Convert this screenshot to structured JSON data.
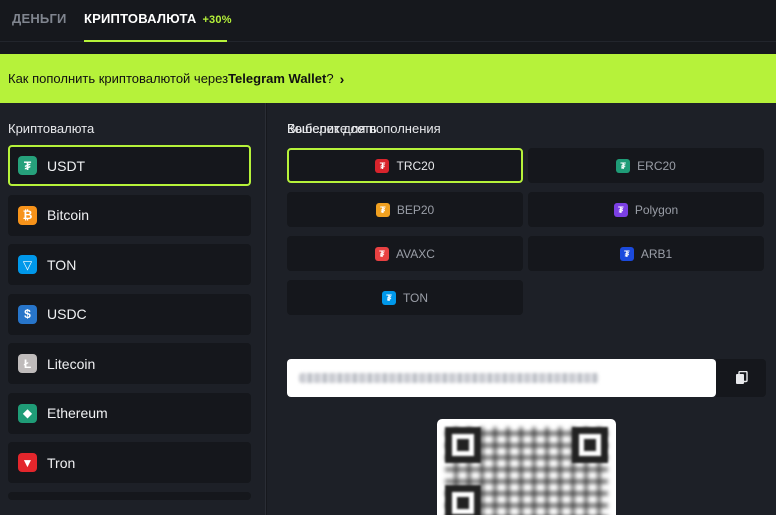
{
  "tabs": {
    "money": "Деньги",
    "crypto": "Криптовалюта",
    "crypto_badge": "+30%"
  },
  "banner": {
    "text_before": "Как пополнить криптовалютой через ",
    "text_bold": "Telegram Wallet",
    "text_after": "?",
    "chevron": "›"
  },
  "crypto_panel": {
    "title": "Криптовалюта",
    "items": [
      {
        "label": "USDT",
        "icon": "tether-icon",
        "color": "#26a17b",
        "selected": true
      },
      {
        "label": "Bitcoin",
        "icon": "bitcoin-icon",
        "color": "#f7931a",
        "selected": false
      },
      {
        "label": "TON",
        "icon": "ton-icon",
        "color": "#0098ea",
        "selected": false
      },
      {
        "label": "USDC",
        "icon": "usdc-icon",
        "color": "#2775ca",
        "selected": false
      },
      {
        "label": "Litecoin",
        "icon": "litecoin-icon",
        "color": "#bfbbbb",
        "selected": false
      },
      {
        "label": "Ethereum",
        "icon": "ethereum-icon",
        "color": "#1f9c77",
        "selected": false
      },
      {
        "label": "Tron",
        "icon": "tron-icon",
        "color": "#e3262c",
        "selected": false
      }
    ]
  },
  "network_panel": {
    "title": "Выберите сеть",
    "networks": [
      {
        "label": "TRC20",
        "color": "#d8242c",
        "selected": true
      },
      {
        "label": "ERC20",
        "color": "#1f9c77",
        "selected": false
      },
      {
        "label": "BEP20",
        "color": "#f0a020",
        "selected": false
      },
      {
        "label": "Polygon",
        "color": "#7b3fe4",
        "selected": false
      },
      {
        "label": "AVAXC",
        "color": "#e84142",
        "selected": false
      },
      {
        "label": "ARB1",
        "color": "#1b4add",
        "selected": false
      },
      {
        "label": "TON",
        "color": "#0098ea",
        "selected": false
      }
    ]
  },
  "wallet": {
    "title": "Кошелек для пополнения",
    "copy_icon": "copy-icon"
  },
  "colors": {
    "accent": "#b6f23a",
    "background": "#16181d",
    "panel": "#1d2027"
  }
}
